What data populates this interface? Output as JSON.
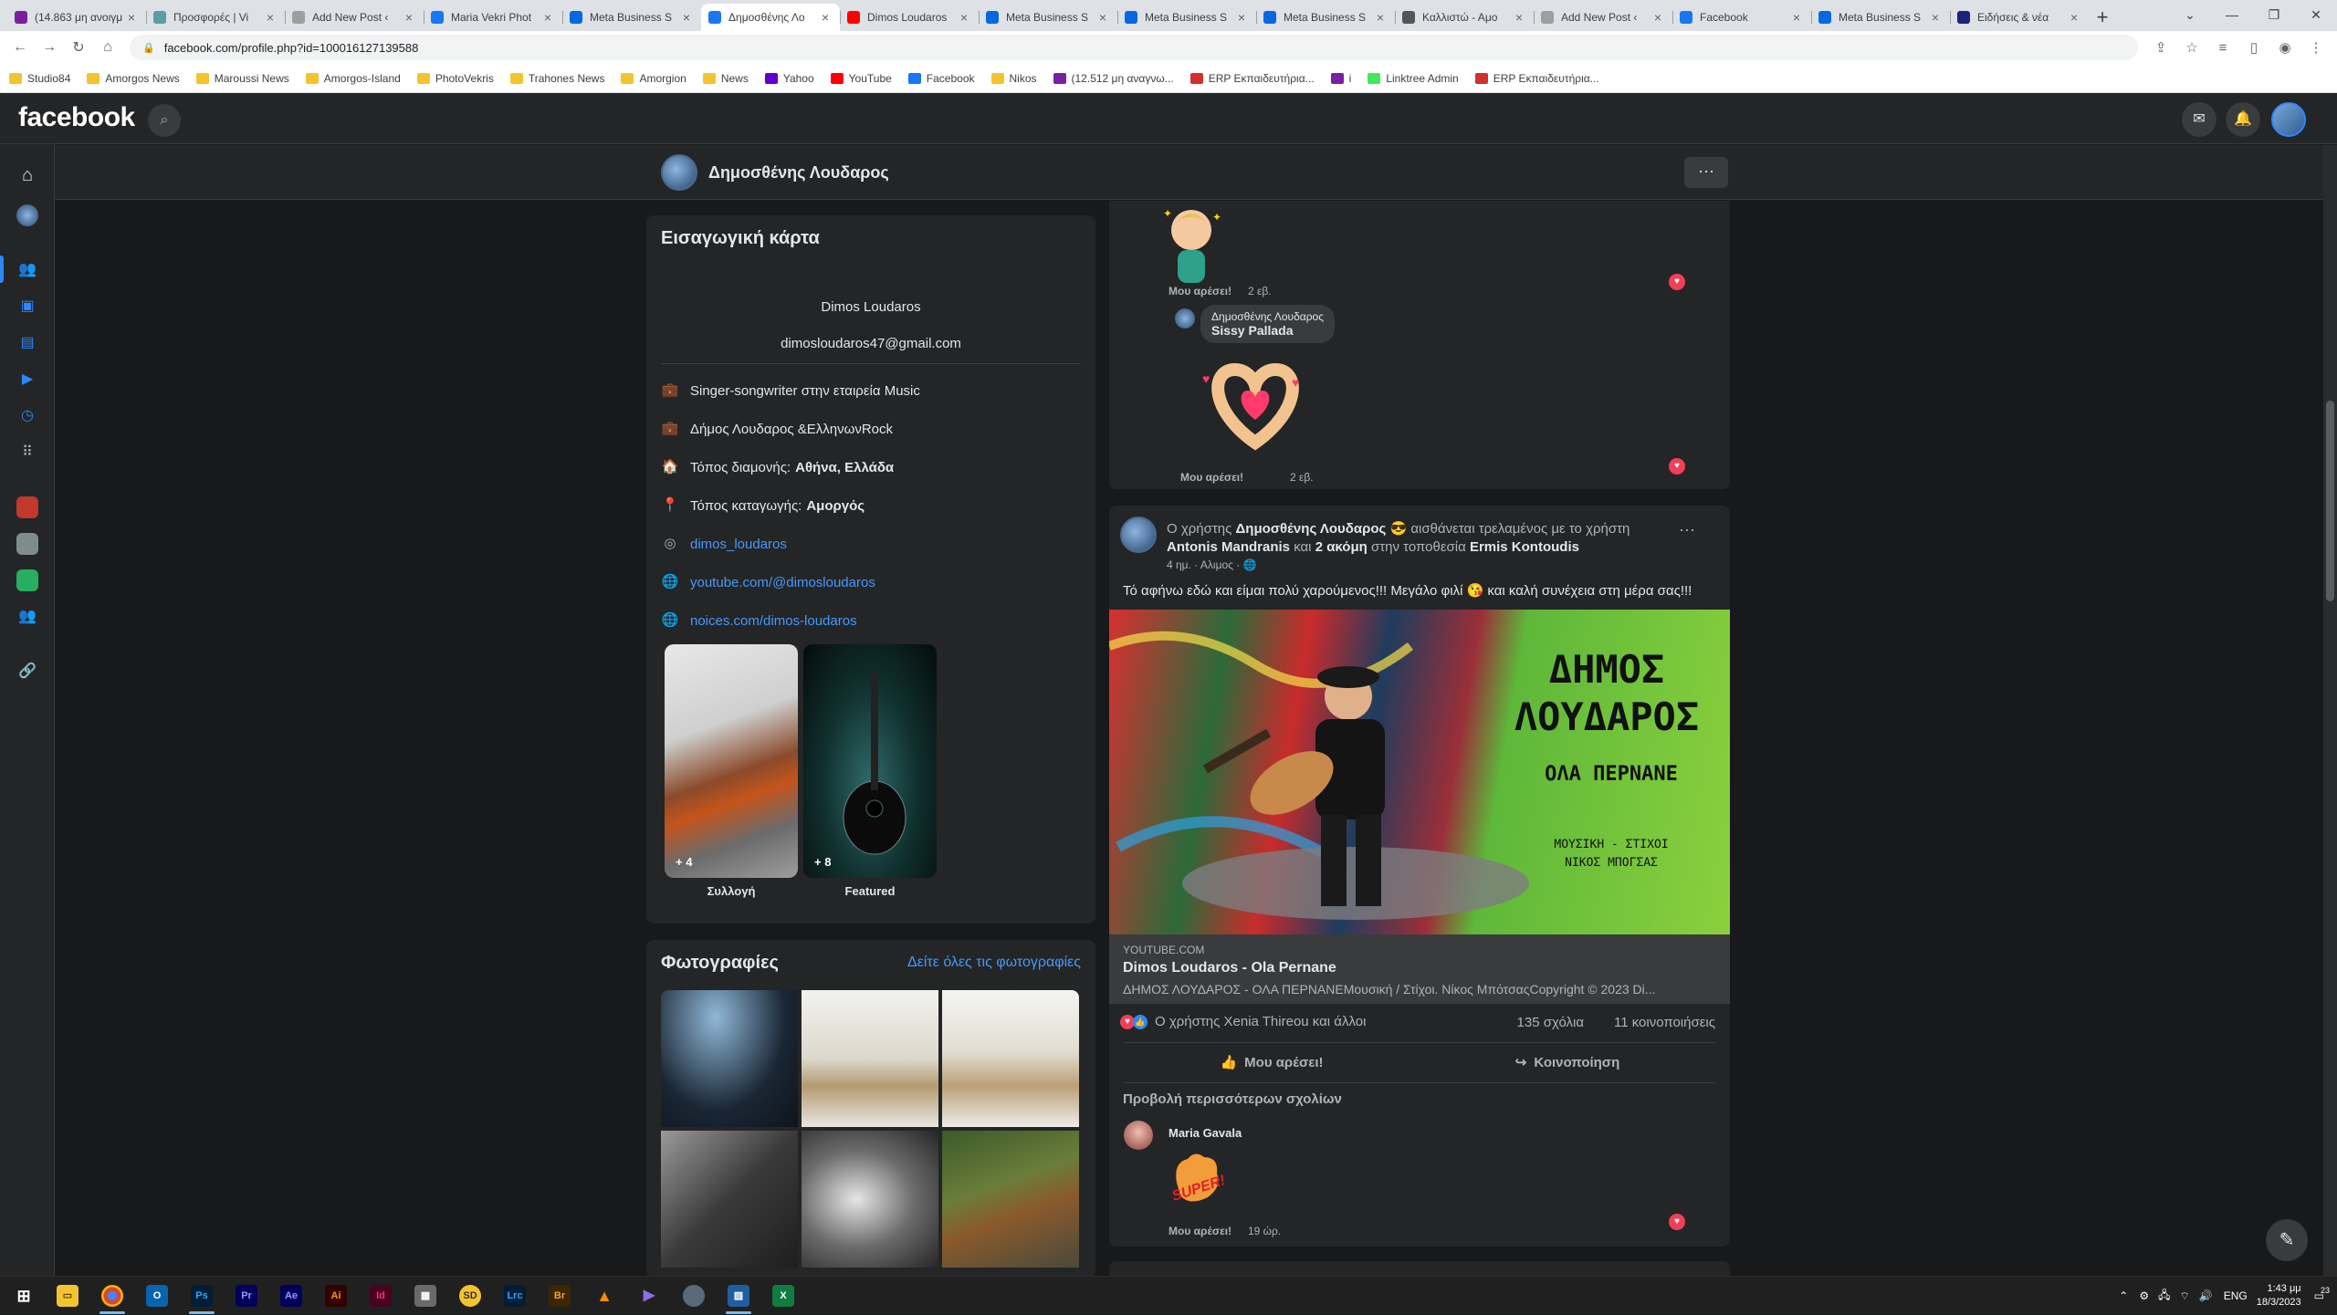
{
  "browser": {
    "tabs": [
      {
        "title": "(14.863 μη ανοιγμ",
        "fav_color": "#7b1fa2"
      },
      {
        "title": "Προσφορές | Vi",
        "fav_color": "#5f9ea0"
      },
      {
        "title": "Add New Post ‹",
        "fav_color": "#9e9e9e"
      },
      {
        "title": "Maria Vekri Phot",
        "fav_color": "#1877f2"
      },
      {
        "title": "Meta Business S",
        "fav_color": "#0668e1"
      },
      {
        "title": "Δημοσθένης Λο",
        "fav_color": "#1877f2"
      },
      {
        "title": "Dimos Loudaros",
        "fav_color": "#ff0000"
      },
      {
        "title": "Meta Business S",
        "fav_color": "#0668e1"
      },
      {
        "title": "Meta Business S",
        "fav_color": "#0668e1"
      },
      {
        "title": "Meta Business S",
        "fav_color": "#0668e1"
      },
      {
        "title": "Καλλιστώ - Αμο",
        "fav_color": "#555555"
      },
      {
        "title": "Add New Post ‹",
        "fav_color": "#9e9e9e"
      },
      {
        "title": "Facebook",
        "fav_color": "#1877f2"
      },
      {
        "title": "Meta Business S",
        "fav_color": "#0668e1"
      },
      {
        "title": "Ειδήσεις & νέα",
        "fav_color": "#1a237e"
      }
    ],
    "new_tab": "+",
    "url": "facebook.com/profile.php?id=100016127139588",
    "bookmarks": [
      {
        "label": "Studio84",
        "color": "#f4c430"
      },
      {
        "label": "Amorgos News",
        "color": "#f4c430"
      },
      {
        "label": "Maroussi News",
        "color": "#f4c430"
      },
      {
        "label": "Amorgos-Island",
        "color": "#f4c430"
      },
      {
        "label": "PhotoVekris",
        "color": "#f4c430"
      },
      {
        "label": "Trahones News",
        "color": "#f4c430"
      },
      {
        "label": "Amorgion",
        "color": "#f4c430"
      },
      {
        "label": "News",
        "color": "#f4c430"
      },
      {
        "label": "Yahoo",
        "color": "#6001d2"
      },
      {
        "label": "YouTube",
        "color": "#ff0000"
      },
      {
        "label": "Facebook",
        "color": "#1877f2"
      },
      {
        "label": "Nikos",
        "color": "#f4c430"
      },
      {
        "label": "(12.512 μη αναγνω...",
        "color": "#7b1fa2"
      },
      {
        "label": "ERP Εκπαιδευτήρια...",
        "color": "#d32f2f"
      },
      {
        "label": "i",
        "color": "#7b1fa2"
      },
      {
        "label": "Linktree Admin",
        "color": "#43e660"
      },
      {
        "label": "ERP Εκπαιδευτήρια...",
        "color": "#d32f2f"
      }
    ]
  },
  "fb": {
    "logo": "facebook",
    "profile_name": "Δημοσθένης Λουδαρος",
    "more": "···",
    "intro": {
      "title": "Εισαγωγική κάρτα",
      "bio_name": "Dimos Loudaros",
      "bio_email": "dimosloudaros47@gmail.com",
      "work1": "Singer-songwriter στην εταιρεία Music",
      "work2": "Δήμος Λουδαρος &ΕλληνωνRock",
      "lives_label": "Τόπος διαμονής:",
      "lives_value": "Αθήνα, Ελλάδα",
      "from_label": "Τόπος καταγωγής:",
      "from_value": "Αμοργός",
      "instagram": "dimos_loudaros",
      "youtube": "youtube.com/@dimosloudaros",
      "noices": "noices.com/dimos-loudaros",
      "featured": [
        {
          "count": "+ 4",
          "label": "Συλλογή"
        },
        {
          "count": "+ 8",
          "label": "Featured"
        }
      ]
    },
    "photos": {
      "title": "Φωτογραφίες",
      "see_all": "Δείτε όλες τις φωτογραφίες"
    },
    "comments": {
      "like1": "Μου αρέσει!",
      "time1": "2 εβ.",
      "reply_name": "Δημοσθένης Λουδαρος",
      "reply_text": "Sissy Pallada",
      "like2": "Μου αρέσει!",
      "time2": "2 εβ."
    },
    "post": {
      "hdr_prefix": "Ο χρήστης",
      "author": "Δημοσθένης Λουδαρος",
      "feeling": "αισθάνεται τρελαμένος με το χρήστη",
      "tag1": "Antonis Mandranis",
      "and": "και",
      "tag_more": "2 ακόμη",
      "at": "στην τοποθεσία",
      "place": "Ermis Kontoudis",
      "meta": "4 ημ. · Αλιμος · ",
      "text": "Τό αφήνω εδώ και είμαι πολύ χαρούμενος!!! Μεγάλο φιλί 😘 και καλή συνέχεια στη μέρα σας!!!",
      "poster_title_1": "ΔΗΜΟΣ",
      "poster_title_2": "ΛΟΥΔΑΡΟΣ",
      "poster_song": "ΟΛΑ ΠΕΡΝΑΝΕ",
      "poster_credit_1": "ΜΟΥΣΙΚΗ - ΣΤΙΧΟΙ",
      "poster_credit_2": "ΝΙΚΟΣ ΜΠΟΓΣΑΣ",
      "link_domain": "YOUTUBE.COM",
      "link_title": "Dimos Loudaros - Ola Pernane",
      "link_desc": "ΔΗΜΟΣ ΛΟΥΔΑΡΟΣ - ΟΛΑ ΠΕΡΝΑΝΕΜουσική / Στίχοι. Νίκος ΜπότσαςCopyright © 2023 Di...",
      "reactions": "Ο χρήστης Xenia Thireou και άλλοι",
      "comments_count": "135 σχόλια",
      "shares_count": "11 κοινοποιήσεις",
      "like_btn": "Μου αρέσει!",
      "share_btn": "Κοινοποίηση",
      "more_comments": "Προβολή περισσότερων σχολίων",
      "commenter": "Maria Gavala",
      "sticker_text": "SUPER!",
      "c_like": "Μου αρέσει!",
      "c_time": "19 ώρ."
    }
  },
  "taskbar": {
    "lang": "ENG",
    "time": "1:43 μμ",
    "date": "18/3/2023",
    "notif": "23"
  }
}
